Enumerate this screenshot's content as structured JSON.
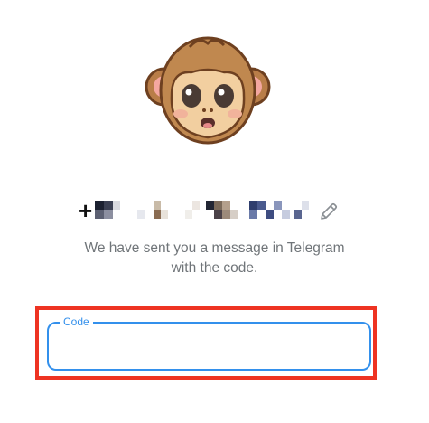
{
  "auth": {
    "phone_number": "+",
    "message_line1": "We have sent you a message in Telegram",
    "message_line2": "with the code.",
    "code_label": "Code",
    "code_value": ""
  },
  "icons": {
    "avatar": "monkey-face-icon",
    "edit": "pencil-icon"
  },
  "colors": {
    "accent": "#3390ec",
    "secondary_text": "#707579",
    "highlight": "#ee3322"
  }
}
